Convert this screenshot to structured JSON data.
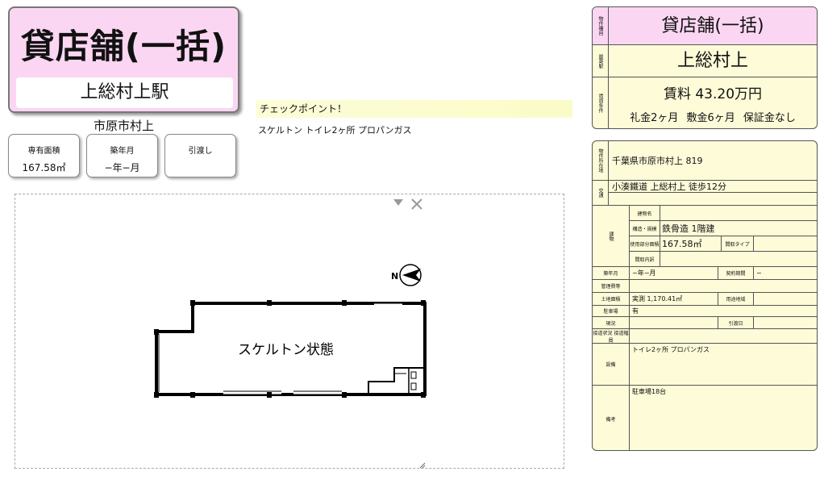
{
  "title": {
    "type": "貸店舗(一括)",
    "station": "上総村上駅",
    "city": "市原市村上"
  },
  "mini": [
    {
      "label": "専有面積",
      "value": "167.58㎡"
    },
    {
      "label": "築年月",
      "value": "−年−月"
    },
    {
      "label": "引渡し",
      "value": ""
    }
  ],
  "checkpoint": {
    "label": "チェックポイント！",
    "facilities": "スケルトン トイレ2ヶ所 プロパンガス"
  },
  "plan": {
    "room_label": "スケルトン状態",
    "north": "N"
  },
  "summary": {
    "side1": "物件種目",
    "side2": "最寄駅",
    "side3": "賃貸条件",
    "type": "貸店舗(一括)",
    "station": "上総村上",
    "rent": "賃料 43.20万円",
    "fees": "礼金2ヶ月 敷金6ヶ月 保証金なし"
  },
  "detail": {
    "loc_side": "物件所在地",
    "address": "千葉県市原市村上 819",
    "traffic_side": "交通",
    "traffic": "小湊鐵道 上総村上 徒歩12分",
    "bldg_side": "建物",
    "bldg_name_lbl": "建物名",
    "structure_lbl": "構造・規模",
    "structure": "鉄骨造 1階建",
    "area_lbl": "使用部分面積",
    "area": "167.58㎡",
    "layout_type_lbl": "間取タイプ",
    "layout_detail_lbl": "間取内訳",
    "built_lbl": "築年月",
    "built": "−年−月",
    "contract_lbl": "契約期間",
    "contract": "−",
    "mgmt_lbl": "管理費等",
    "land_lbl": "土地面積",
    "land": "実測 1,170.41㎡",
    "use_lbl": "用途地域",
    "parking_lbl": "駐車場",
    "parking": "有",
    "status_lbl": "現況",
    "handover_lbl": "引渡日",
    "conn_lbl": "接道状況 接道幅員",
    "equip_lbl": "設備",
    "equip": "トイレ2ヶ所 プロパンガス",
    "notes_lbl": "備考",
    "notes": "駐車場18台"
  }
}
